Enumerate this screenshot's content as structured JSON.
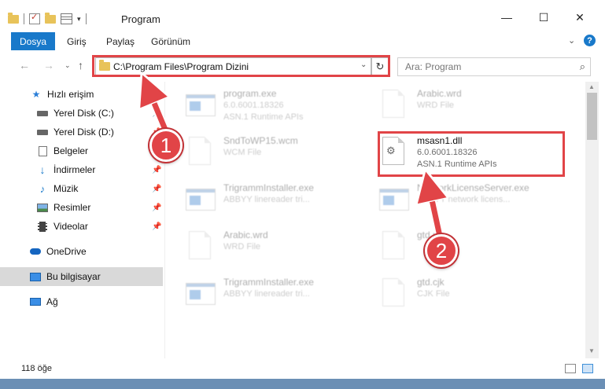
{
  "window": {
    "title": "Program",
    "controls": {
      "minimize": "—",
      "maximize": "☐",
      "close": "✕"
    }
  },
  "ribbon": {
    "tabs": [
      "Dosya",
      "Giriş",
      "Paylaş",
      "Görünüm"
    ],
    "help": "?"
  },
  "navigation": {
    "address": "C:\\Program Files\\Program Dizini",
    "search_placeholder": "Ara: Program"
  },
  "sidebar": {
    "items": [
      {
        "label": "Hızlı erişim",
        "icon": "star-icon"
      },
      {
        "label": "Yerel Disk (C:)",
        "icon": "drive-icon",
        "pinned": true
      },
      {
        "label": "Yerel Disk (D:)",
        "icon": "drive-icon",
        "pinned": true
      },
      {
        "label": "Belgeler",
        "icon": "documents-icon",
        "pinned": true
      },
      {
        "label": "İndirmeler",
        "icon": "download-icon",
        "pinned": true
      },
      {
        "label": "Müzik",
        "icon": "music-icon",
        "pinned": true
      },
      {
        "label": "Resimler",
        "icon": "pictures-icon",
        "pinned": true
      },
      {
        "label": "Videolar",
        "icon": "videos-icon",
        "pinned": true
      },
      {
        "label": "OneDrive",
        "icon": "cloud-icon"
      },
      {
        "label": "Bu bilgisayar",
        "icon": "computer-icon",
        "selected": true
      },
      {
        "label": "Ağ",
        "icon": "network-icon"
      }
    ]
  },
  "files": [
    {
      "name": "program.exe",
      "line1": "6.0.6001.18326",
      "line2": "ASN.1 Runtime APIs",
      "kind": "exe"
    },
    {
      "name": "Arabic.wrd",
      "line1": "WRD File",
      "line2": "",
      "kind": "doc"
    },
    {
      "name": "SndToWP15.wcm",
      "line1": "WCM File",
      "line2": "",
      "kind": "doc"
    },
    {
      "name": "msasn1.dll",
      "line1": "6.0.6001.18326",
      "line2": "ASN.1 Runtime APIs",
      "kind": "dll"
    },
    {
      "name": "TrigrammInstaller.exe",
      "line1": "ABBYY linereader trі...",
      "line2": "",
      "kind": "exe"
    },
    {
      "name": "NetworkLicenseServer.exe",
      "line1": "ABBYY network licens...",
      "line2": "",
      "kind": "exe"
    },
    {
      "name": "Arabic.wrd",
      "line1": "WRD File",
      "line2": "",
      "kind": "doc"
    },
    {
      "name": "gtd.ptt",
      "line1": "",
      "line2": "",
      "kind": "doc"
    },
    {
      "name": "TrigrammInstaller.exe",
      "line1": "ABBYY linereader trі...",
      "line2": "",
      "kind": "exe"
    },
    {
      "name": "gtd.cjk",
      "line1": "CJK File",
      "line2": "",
      "kind": "doc"
    }
  ],
  "status": {
    "count": "118 öğe"
  },
  "annotations": {
    "step1": "1",
    "step2": "2",
    "color": "#e14447"
  }
}
